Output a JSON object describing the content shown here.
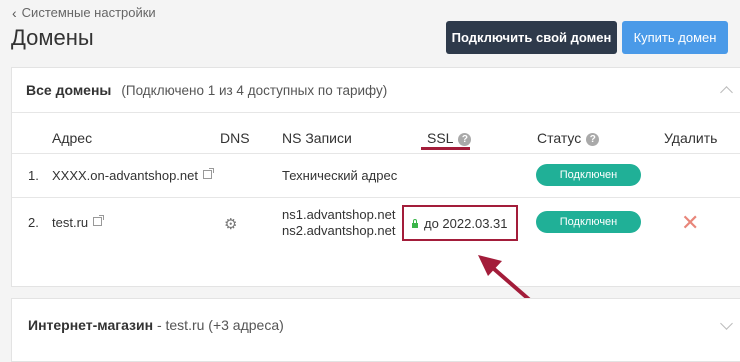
{
  "header": {
    "back_label": "Системные настройки",
    "title": "Домены",
    "connect_button": "Подключить свой домен",
    "buy_button": "Купить домен"
  },
  "all_domains": {
    "title": "Все домены",
    "subtitle": "(Подключено 1 из 4 доступных по тарифу)",
    "columns": {
      "address": "Адрес",
      "dns": "DNS",
      "ns": "NS Записи",
      "ssl": "SSL",
      "status": "Статус",
      "delete": "Удалить"
    },
    "rows": [
      {
        "num": "1.",
        "address": "XXXX.on-advantshop.net",
        "ns1": "Технический адрес",
        "ns2": "",
        "ssl": "",
        "status": "Подключен"
      },
      {
        "num": "2.",
        "address": "test.ru",
        "ns1": "ns1.advantshop.net",
        "ns2": "ns2.advantshop.net",
        "ssl": "до 2022.03.31",
        "status": "Подключен"
      }
    ]
  },
  "store": {
    "title": "Интернет-магазин",
    "subtitle": " - test.ru (+3 адреса)"
  },
  "colors": {
    "annotation": "#a31d3a",
    "status_green": "#20b097",
    "primary_dark": "#2e3a4b",
    "primary_blue": "#4a9ae8",
    "delete_red": "#e8867a"
  },
  "icons": [
    "chevron-left-icon",
    "help-icon",
    "external-link-icon",
    "gear-icon",
    "delete-icon",
    "lock-icon",
    "chevron-up-icon",
    "chevron-down-icon",
    "annotation-arrow"
  ]
}
